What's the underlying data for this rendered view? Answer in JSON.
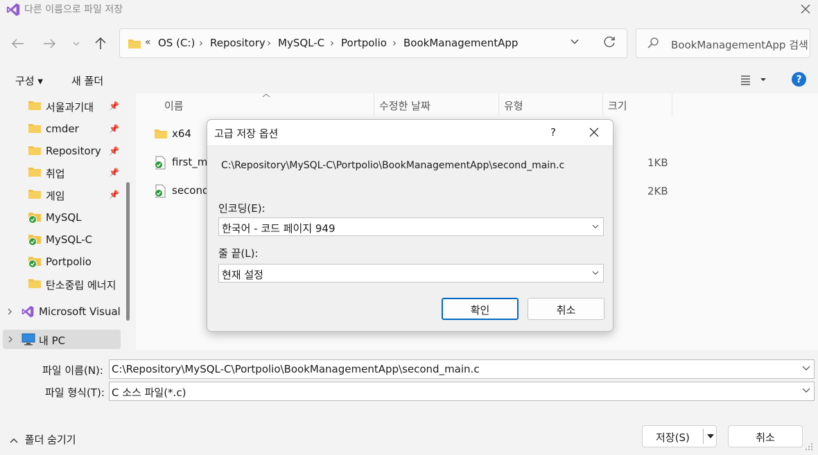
{
  "window": {
    "title": "다른 이름으로 파일 저장"
  },
  "address": {
    "overflow": "«",
    "crumbs": [
      "OS (C:)",
      "Repository",
      "MySQL-C",
      "Portpolio",
      "BookManagementApp"
    ],
    "separator": "›"
  },
  "search": {
    "placeholder": "BookManagementApp 검색"
  },
  "commandbar": {
    "organize": "구성 ▾",
    "new_folder": "새 폴더",
    "help": "?"
  },
  "nav": {
    "items": [
      {
        "label": "서울과기대",
        "icon": "folder-icon",
        "pinned": true
      },
      {
        "label": "cmder",
        "icon": "folder-icon",
        "pinned": true
      },
      {
        "label": "Repository",
        "icon": "folder-icon",
        "pinned": true
      },
      {
        "label": "취업",
        "icon": "folder-icon",
        "pinned": true
      },
      {
        "label": "게임",
        "icon": "folder-icon",
        "pinned": true
      },
      {
        "label": "MySQL",
        "icon": "synced-folder-icon",
        "pinned": false
      },
      {
        "label": "MySQL-C",
        "icon": "synced-folder-icon",
        "pinned": false
      },
      {
        "label": "Portpolio",
        "icon": "synced-folder-icon",
        "pinned": false
      },
      {
        "label": "탄소중립 에너지",
        "icon": "folder-icon",
        "pinned": false
      }
    ],
    "vs_label": "Microsoft Visual S",
    "pc_label": "내 PC"
  },
  "columns": {
    "name": "이름",
    "modified": "수정한 날짜",
    "type": "유형",
    "size": "크기"
  },
  "files": [
    {
      "name": "x64",
      "size": ""
    },
    {
      "name": "first_ma",
      "size": "1KB"
    },
    {
      "name": "second_",
      "size": "2KB"
    }
  ],
  "bottom": {
    "filename_label": "파일 이름(N):",
    "filename_value": "C:\\Repository\\MySQL-C\\Portpolio\\BookManagementApp\\second_main.c",
    "filetype_label": "파일 형식(T):",
    "filetype_value": "C 소스 파일(*.c)",
    "hide_folders": "폴더 숨기기",
    "save": "저장(S)",
    "cancel": "취소"
  },
  "dialog": {
    "title": "고급 저장 옵션",
    "help": "?",
    "path": "C:\\Repository\\MySQL-C\\Portpolio\\BookManagementApp\\second_main.c",
    "encoding_label": "인코딩(E):",
    "encoding_value": "한국어 - 코드 페이지 949",
    "eol_label": "줄 끝(L):",
    "eol_value": "현재 설정",
    "ok": "확인",
    "cancel": "취소"
  },
  "colors": {
    "accent": "#0067c0",
    "help_badge": "#1a73d0",
    "folder": "#f3c249",
    "sync_green": "#2c9a3a"
  }
}
